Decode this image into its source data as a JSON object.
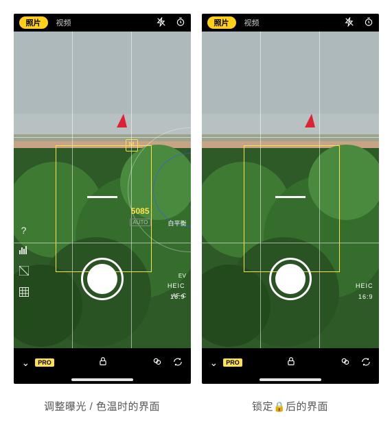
{
  "panels": [
    {
      "topbar": {
        "photo": "照片",
        "video": "视频"
      },
      "dial": {
        "kelvin": "5085",
        "auto": "AUTO",
        "m": "M",
        "wb": "白平衡"
      },
      "right": {
        "ev": "EV",
        "afc": "AF-C",
        "format": "HEIC",
        "aspect": "16:9"
      },
      "bottom": {
        "pro": "PRO"
      },
      "caption": "调整曝光 / 色温时的界面"
    },
    {
      "topbar": {
        "photo": "照片",
        "video": "视频"
      },
      "right": {
        "format": "HEIC",
        "aspect": "16:9"
      },
      "bottom": {
        "pro": "PRO"
      },
      "caption_prefix": "锁定",
      "caption_suffix": "后的界面"
    }
  ]
}
